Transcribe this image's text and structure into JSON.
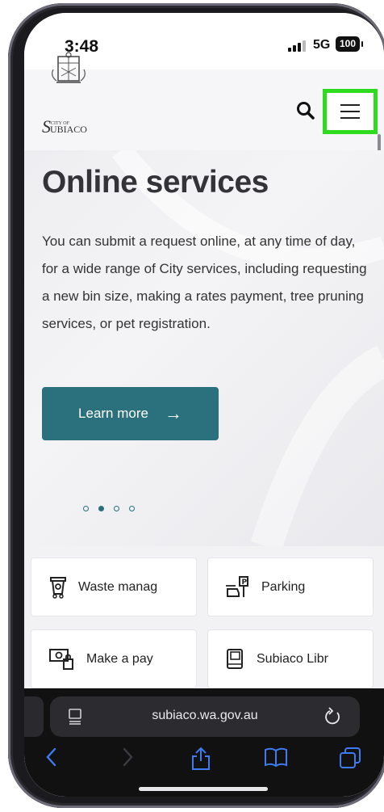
{
  "status_bar": {
    "time": "3:48",
    "network": "5G",
    "battery": "100"
  },
  "header": {
    "logo_text_small": "CITY OF",
    "logo_text": "UBIACO",
    "logo_initial": "S",
    "search_icon": "search-icon",
    "menu_icon": "hamburger-menu-icon",
    "highlight_color": "#2edb1e"
  },
  "hero": {
    "title": "Online services",
    "description": "You can submit a request online, at any time of day, for a wide range of City services, including requesting a new bin size, making a rates payment, tree pruning services, or pet registration.",
    "button_label": "Learn more",
    "button_arrow": "→",
    "accent_color": "#2a707d",
    "carousel": {
      "count": 4,
      "active_index": 1
    }
  },
  "services": [
    {
      "label": "Waste manag",
      "icon": "waste-bin-icon"
    },
    {
      "label": "Parking",
      "icon": "parking-icon"
    },
    {
      "label": "Make a pay",
      "icon": "payment-icon"
    },
    {
      "label": "Subiaco Libr",
      "icon": "library-book-icon"
    }
  ],
  "browser": {
    "url": "subiaco.wa.gov.au",
    "toolbar": [
      "back-icon",
      "forward-icon",
      "share-icon",
      "bookmarks-icon",
      "tabs-icon"
    ]
  }
}
